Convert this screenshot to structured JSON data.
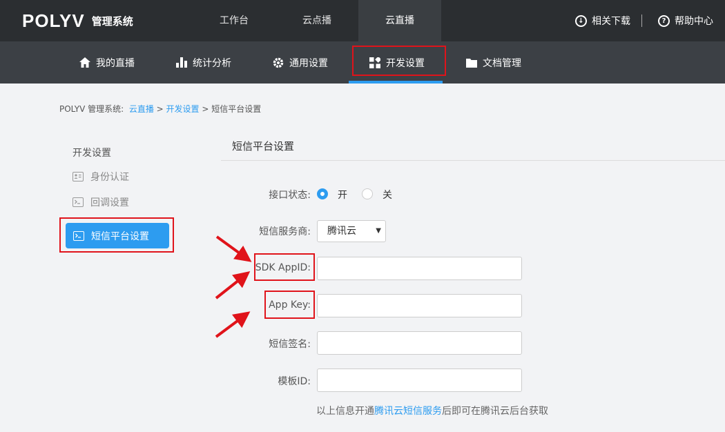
{
  "app": {
    "logo": "POLYV",
    "logo_sub": "管理系统"
  },
  "top_nav": [
    {
      "label": "工作台"
    },
    {
      "label": "云点播"
    },
    {
      "label": "云直播"
    }
  ],
  "top_right": {
    "download": "相关下载",
    "help": "帮助中心"
  },
  "sub_nav": [
    {
      "label": "我的直播",
      "icon": "home-icon"
    },
    {
      "label": "统计分析",
      "icon": "bar-chart-icon"
    },
    {
      "label": "通用设置",
      "icon": "gear-icon"
    },
    {
      "label": "开发设置",
      "icon": "grid-icon"
    },
    {
      "label": "文档管理",
      "icon": "folder-icon"
    }
  ],
  "breadcrumb": {
    "root": "POLYV 管理系统:",
    "level1": "云直播",
    "sep": ">",
    "level2": "开发设置",
    "current": "短信平台设置"
  },
  "sidebar": {
    "heading": "开发设置",
    "items": [
      {
        "label": "身份认证",
        "icon": "id-card-icon"
      },
      {
        "label": "回调设置",
        "icon": "terminal-icon"
      },
      {
        "label": "短信平台设置",
        "icon": "terminal-icon"
      }
    ]
  },
  "panel": {
    "title": "短信平台设置",
    "status_label": "接口状态:",
    "status_on": "开",
    "status_off": "关",
    "provider_label": "短信服务商:",
    "provider_value": "腾讯云",
    "appid_label": "SDK AppID:",
    "appkey_label": "App Key:",
    "sign_label": "短信签名:",
    "template_label": "模板ID:",
    "hint_before": "以上信息开通",
    "hint_link": "腾讯云短信服务",
    "hint_after": "后即可在腾讯云后台获取"
  },
  "colors": {
    "accent": "#2d9cf0",
    "annotation": "#e0131a",
    "topbar": "#2b2e31",
    "subnav": "#3c4045"
  }
}
